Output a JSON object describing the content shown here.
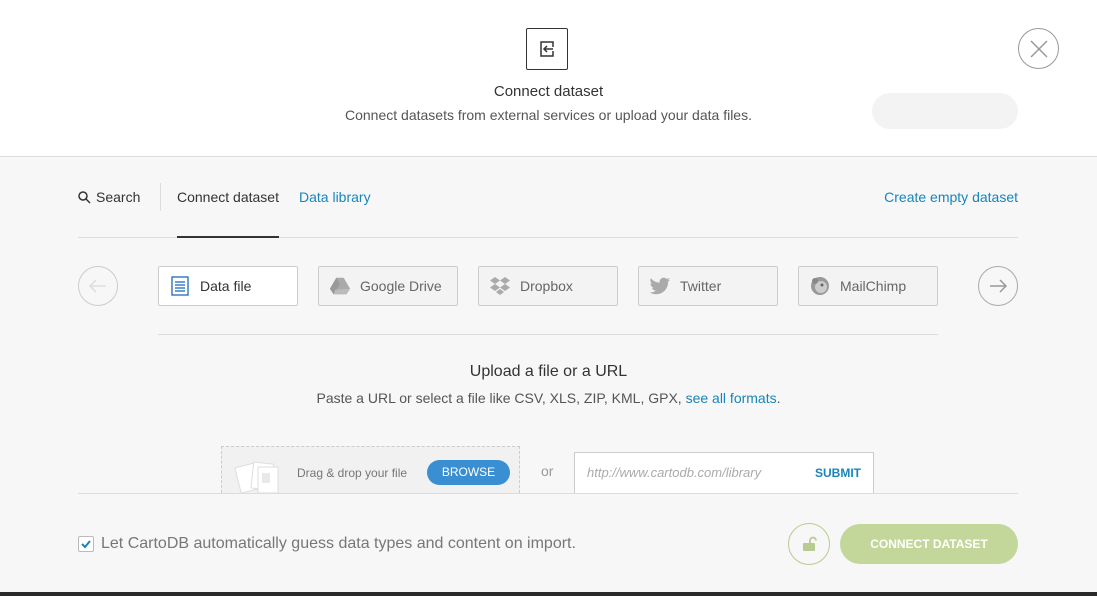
{
  "header": {
    "title": "Connect dataset",
    "subtitle": "Connect datasets from external services or upload your data files.",
    "icon": "connect-dataset-icon",
    "close_icon": "close-icon"
  },
  "tabs": {
    "search": "Search",
    "connect": "Connect dataset",
    "library": "Data library",
    "create_empty": "Create empty dataset"
  },
  "connectors": [
    {
      "label": "Data file",
      "icon": "data-file-icon",
      "active": true
    },
    {
      "label": "Google Drive",
      "icon": "google-drive-icon",
      "active": false
    },
    {
      "label": "Dropbox",
      "icon": "dropbox-icon",
      "active": false
    },
    {
      "label": "Twitter",
      "icon": "twitter-icon",
      "active": false
    },
    {
      "label": "MailChimp",
      "icon": "mailchimp-icon",
      "active": false
    }
  ],
  "upload": {
    "title": "Upload a file or a URL",
    "subtitle_prefix": "Paste a URL or select a file like CSV, XLS, ZIP, KML, GPX,",
    "formats_link": "see all formats",
    "subtitle_suffix": ".",
    "drag_text": "Drag & drop your file",
    "browse": "BROWSE",
    "or": "or",
    "url_placeholder": "http://www.cartodb.com/library",
    "submit": "SUBMIT"
  },
  "footer": {
    "guess_label": "Let CartoDB automatically guess data types and content on import.",
    "guess_checked": true,
    "connect_button": "CONNECT DATASET"
  },
  "colors": {
    "link": "#1785bb",
    "browse": "#3a8fd3",
    "connect_button": "#c3d79a"
  }
}
